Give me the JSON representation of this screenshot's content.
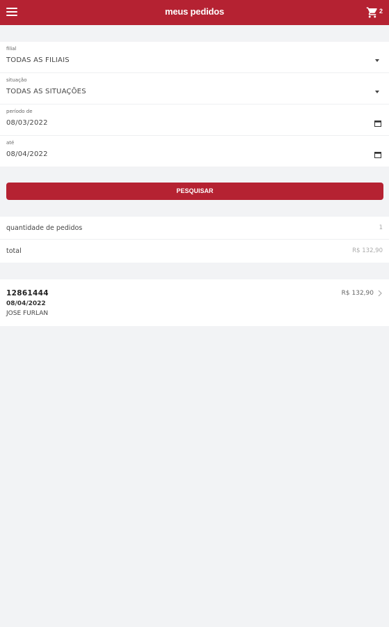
{
  "appbar": {
    "title": "meus pedidos",
    "cart_count": "2"
  },
  "filters": {
    "filial": {
      "label": "filial",
      "value": "TODAS AS FILIAIS"
    },
    "situacao": {
      "label": "situação",
      "value": "TODAS AS SITUAÇÕES"
    },
    "periodo_de": {
      "label": "período de",
      "value": "08/03/2022"
    },
    "ate": {
      "label": "até",
      "value": "08/04/2022"
    }
  },
  "search_button": "PESQUISAR",
  "summary": {
    "quantity_label": "quantidade de pedidos",
    "quantity_value": "1",
    "total_label": "total",
    "total_value": "R$ 132,90"
  },
  "orders": [
    {
      "number": "12861444",
      "date": "08/04/2022",
      "client": "JOSE FURLAN",
      "value": "R$ 132,90"
    }
  ],
  "colors": {
    "primary": "#b52232",
    "background": "#f2f3f5"
  },
  "icons": [
    "menu-icon",
    "cart-icon",
    "dropdown-arrow-icon",
    "calendar-icon",
    "chevron-right-icon"
  ]
}
